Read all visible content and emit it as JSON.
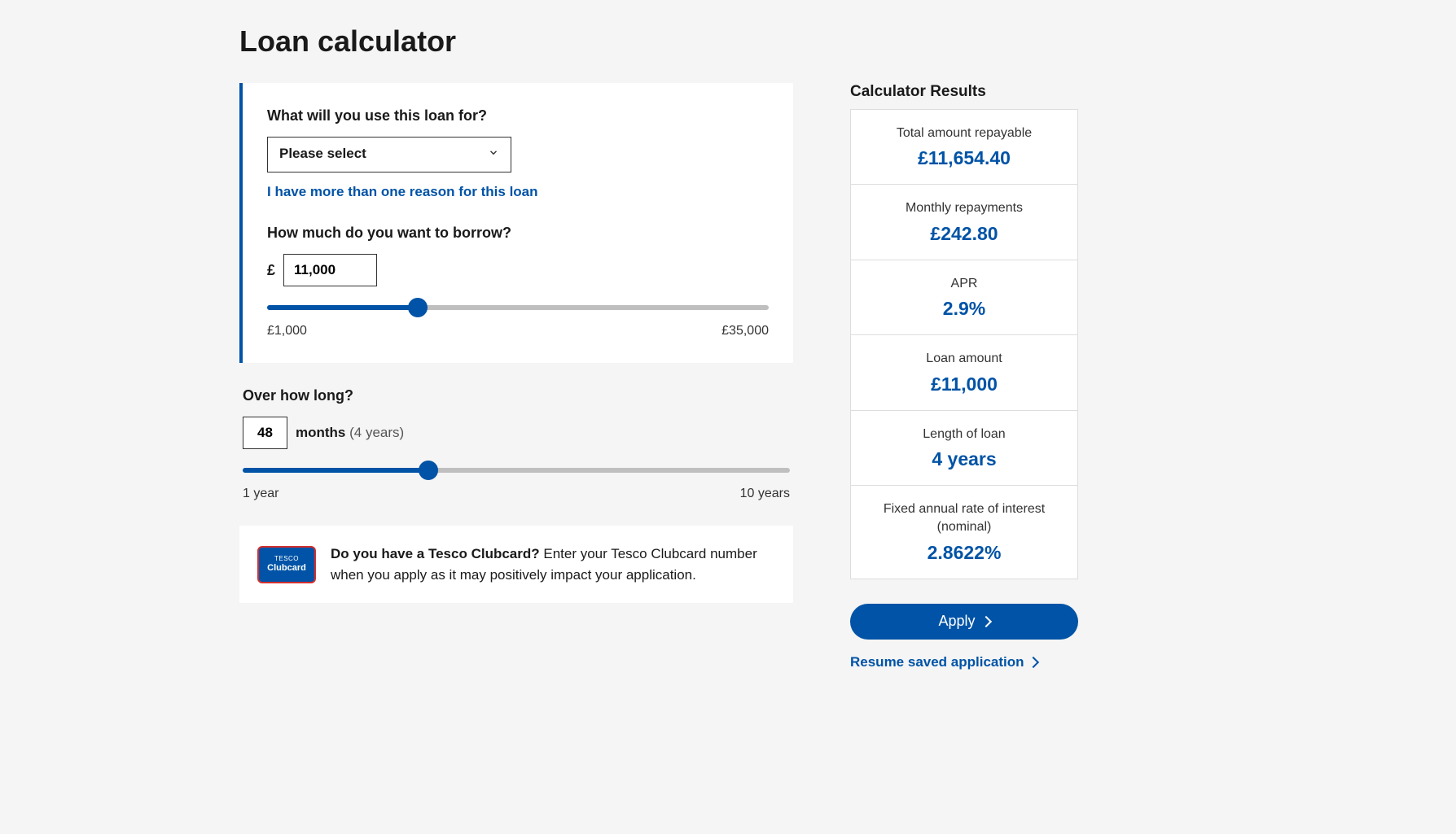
{
  "page": {
    "title": "Loan calculator"
  },
  "purpose": {
    "question": "What will you use this loan for?",
    "select_placeholder": "Please select",
    "multi_reason_link": "I have more than one reason for this loan"
  },
  "amount": {
    "question": "How much do you want to borrow?",
    "currency_symbol": "£",
    "value": "11,000",
    "slider_min_label": "£1,000",
    "slider_max_label": "£35,000",
    "slider_fill_percent": 30
  },
  "term": {
    "question": "Over how long?",
    "months_value": "48",
    "months_word": "months",
    "years_note": "(4 years)",
    "slider_min_label": "1 year",
    "slider_max_label": "10 years",
    "slider_fill_percent": 34
  },
  "clubcard": {
    "badge_top": "TESCO",
    "badge_bottom": "Clubcard",
    "bold": "Do you have a Tesco Clubcard?",
    "rest": " Enter your Tesco Clubcard number when you apply as it may positively impact your application."
  },
  "results": {
    "title": "Calculator Results",
    "rows": [
      {
        "label": "Total amount repayable",
        "value": "£11,654.40"
      },
      {
        "label": "Monthly repayments",
        "value": "£242.80"
      },
      {
        "label": "APR",
        "value": "2.9%"
      },
      {
        "label": "Loan amount",
        "value": "£11,000"
      },
      {
        "label": "Length of loan",
        "value": "4 years"
      },
      {
        "label": "Fixed annual rate of interest (nominal)",
        "value": "2.8622%"
      }
    ],
    "apply_label": "Apply",
    "resume_label": "Resume saved application"
  }
}
